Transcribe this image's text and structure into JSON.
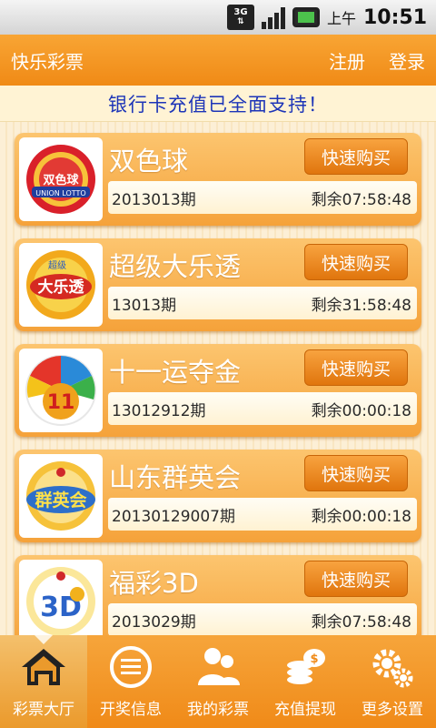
{
  "status_bar": {
    "network": "3G",
    "ampm": "上午",
    "time": "10:51",
    "icons": [
      "network-3g-icon",
      "signal-icon",
      "battery-icon"
    ]
  },
  "header": {
    "title": "快乐彩票",
    "register_label": "注册",
    "login_label": "登录"
  },
  "banner": {
    "text": "银行卡充值已全面支持！"
  },
  "lotteries": [
    {
      "name": "双色球",
      "period": "2013013期",
      "remaining": "剩余07:58:48",
      "buy_label": "快速购买",
      "logo_text": "双色球"
    },
    {
      "name": "超级大乐透",
      "period": "13013期",
      "remaining": "剩余31:58:48",
      "buy_label": "快速购买",
      "logo_text": "大乐透"
    },
    {
      "name": "十一运夺金",
      "period": "13012912期",
      "remaining": "剩余00:00:18",
      "buy_label": "快速购买",
      "logo_text": "11"
    },
    {
      "name": "山东群英会",
      "period": "20130129007期",
      "remaining": "剩余00:00:18",
      "buy_label": "快速购买",
      "logo_text": "群英会"
    },
    {
      "name": "福彩3D",
      "period": "2013029期",
      "remaining": "剩余07:58:48",
      "buy_label": "快速购买",
      "logo_text": "3D"
    }
  ],
  "bottom_nav": [
    {
      "label": "彩票大厅",
      "icon": "home-icon",
      "active": true
    },
    {
      "label": "开奖信息",
      "icon": "list-icon",
      "active": false
    },
    {
      "label": "我的彩票",
      "icon": "users-icon",
      "active": false
    },
    {
      "label": "充值提现",
      "icon": "coins-icon",
      "active": false
    },
    {
      "label": "更多设置",
      "icon": "gear-icon",
      "active": false
    }
  ],
  "colors": {
    "primary_orange": "#f08a16",
    "banner_text": "#1d35b8",
    "card_orange": "#f5a23a"
  }
}
